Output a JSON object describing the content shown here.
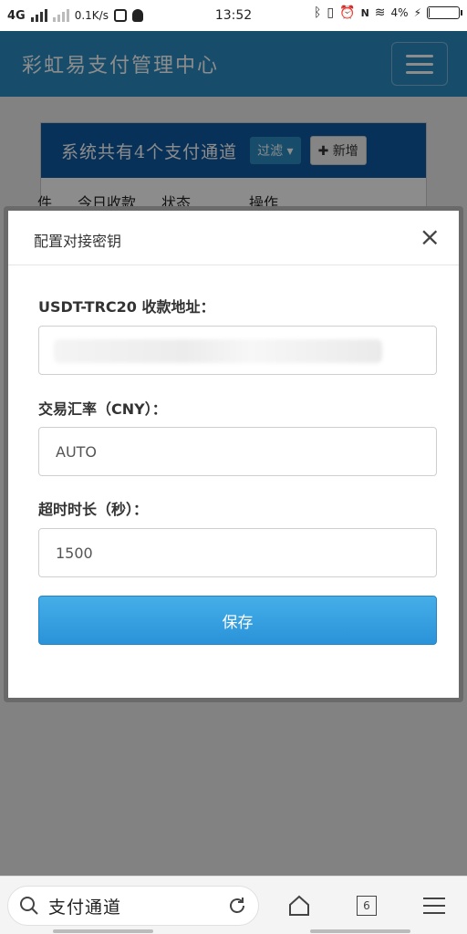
{
  "status_bar": {
    "network": "4G",
    "speed": "0.1K/s",
    "time": "13:52",
    "battery_percent": "4%",
    "battery_level": 0.04,
    "icons": [
      "signal-icon",
      "signal-weak-icon",
      "app-icon",
      "qq-icon",
      "bluetooth-icon",
      "vibrate-icon",
      "alarm-icon",
      "nfc-icon",
      "wifi-icon",
      "charging-icon",
      "battery-icon"
    ]
  },
  "app": {
    "title": "彩虹易支付管理中心",
    "colors": {
      "header": "#2a8cc4",
      "panel_header": "#0e5aa0",
      "primary": "#2a93d9"
    }
  },
  "background_panel": {
    "title": "系统共有4个支付通道",
    "filter_label": "过滤",
    "add_label": "新增",
    "columns": [
      "件",
      "今日收款",
      "状态",
      "操作"
    ]
  },
  "modal": {
    "title": "配置对接密钥",
    "close_symbol": "×",
    "fields": [
      {
        "label": "USDT-TRC20 收款地址：",
        "value": ""
      },
      {
        "label": "交易汇率（CNY）：",
        "value": "AUTO"
      },
      {
        "label": "超时时长（秒）：",
        "value": "1500"
      }
    ],
    "save_label": "保存"
  },
  "browser_bar": {
    "search_text": "支付通道",
    "tab_count": "6"
  }
}
